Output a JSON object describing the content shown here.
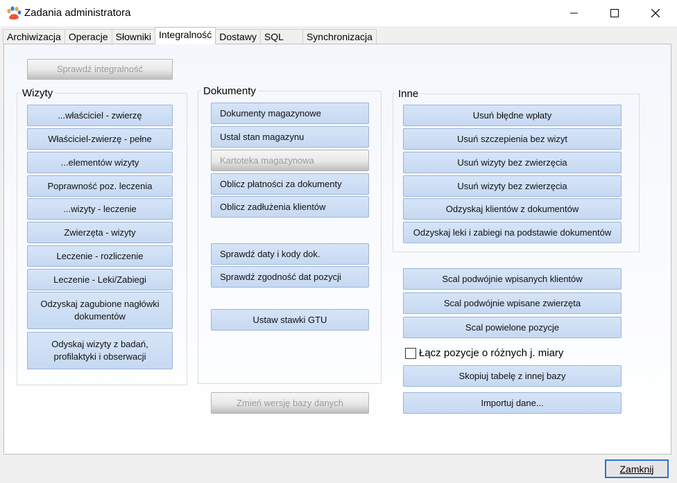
{
  "window": {
    "title": "Zadania administratora",
    "icon": "app-paw-icon",
    "controls": [
      "minimize-icon",
      "maximize-icon",
      "close-icon"
    ]
  },
  "tabs": [
    "Archiwizacja",
    "Operacje",
    "Słowniki",
    "Integralność",
    "Dostawy",
    "SQL",
    "Synchronizacja"
  ],
  "active_tab": "Integralność",
  "check_integrity": {
    "label": "Sprawdź integralność",
    "enabled": false
  },
  "wizyty": {
    "title": "Wizyty",
    "buttons": [
      "...właściciel - zwierzę",
      "Właściciel-zwierzę - pełne",
      "...elementów wizyty",
      "Poprawność poz. leczenia",
      "...wizyty - leczenie",
      "Zwierzęta - wizyty",
      "Leczenie - rozliczenie",
      "Leczenie - Leki/Zabiegi",
      "Odzyskaj zagubione nagłówki dokumentów",
      "Odyskaj wizyty z badań, profilaktyki i obserwacji"
    ]
  },
  "dokumenty": {
    "title": "Dokumenty",
    "buttons": [
      "Dokumenty magazynowe",
      "Ustal stan magazynu",
      "Kartoteka magazynowa",
      "Oblicz płatności za dokumenty",
      "Oblicz zadłużenia klientów",
      "Sprawdź daty i kody dok.",
      "Sprawdź zgodność dat pozycji",
      "Ustaw stawki GTU"
    ],
    "disabled": [
      "Kartoteka magazynowa"
    ]
  },
  "change_db_version": {
    "label": "Zmień wersję bazy danych",
    "enabled": false
  },
  "inne": {
    "title": "Inne",
    "buttons": [
      "Usuń błędne wpłaty",
      "Usuń szczepienia bez wizyt",
      "Usuń wizyty bez zwierzęcia",
      "Usuń wizyty bez zwierzęcia",
      "Odzyskaj klientów z dokumentów",
      "Odzyskaj leki i zabiegi na podstawie dokumentów"
    ]
  },
  "merge": {
    "buttons": [
      "Scal podwójnie wpisanych klientów",
      "Scal podwójnie wpisane zwierzęta",
      "Scal powielone pozycje"
    ],
    "checkbox_label": "Łącz pozycje o różnych j. miary",
    "checkbox_checked": false,
    "copy_table": "Skopiuj tabelę z innej bazy",
    "import": "Importuj dane..."
  },
  "footer": {
    "close": "Zamknij"
  }
}
